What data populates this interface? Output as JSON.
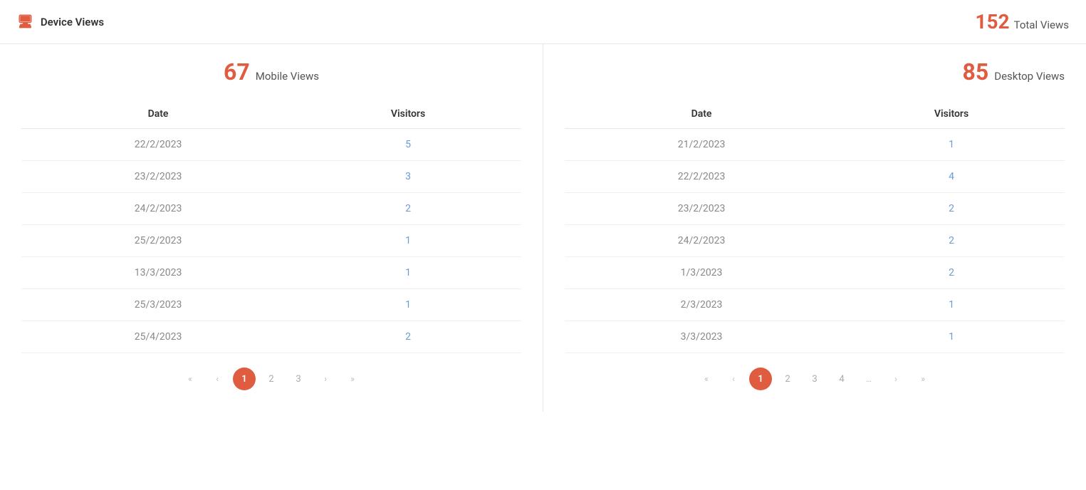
{
  "header": {
    "title": "Device Views",
    "total_views_count": "152",
    "total_views_label": "Total Views"
  },
  "mobile": {
    "count": "67",
    "label": "Mobile Views",
    "table": {
      "col_date": "Date",
      "col_visitors": "Visitors",
      "rows": [
        {
          "date": "22/2/2023",
          "visitors": "5"
        },
        {
          "date": "23/2/2023",
          "visitors": "3"
        },
        {
          "date": "24/2/2023",
          "visitors": "2"
        },
        {
          "date": "25/2/2023",
          "visitors": "1"
        },
        {
          "date": "13/3/2023",
          "visitors": "1"
        },
        {
          "date": "25/3/2023",
          "visitors": "1"
        },
        {
          "date": "25/4/2023",
          "visitors": "2"
        }
      ]
    },
    "pagination": {
      "current": 1,
      "pages": [
        "1",
        "2",
        "3"
      ]
    }
  },
  "desktop": {
    "count": "85",
    "label": "Desktop Views",
    "table": {
      "col_date": "Date",
      "col_visitors": "Visitors",
      "rows": [
        {
          "date": "21/2/2023",
          "visitors": "1"
        },
        {
          "date": "22/2/2023",
          "visitors": "4"
        },
        {
          "date": "23/2/2023",
          "visitors": "2"
        },
        {
          "date": "24/2/2023",
          "visitors": "2"
        },
        {
          "date": "1/3/2023",
          "visitors": "2"
        },
        {
          "date": "2/3/2023",
          "visitors": "1"
        },
        {
          "date": "3/3/2023",
          "visitors": "1"
        }
      ]
    },
    "pagination": {
      "current": 1,
      "pages": [
        "1",
        "2",
        "3",
        "4"
      ]
    }
  }
}
